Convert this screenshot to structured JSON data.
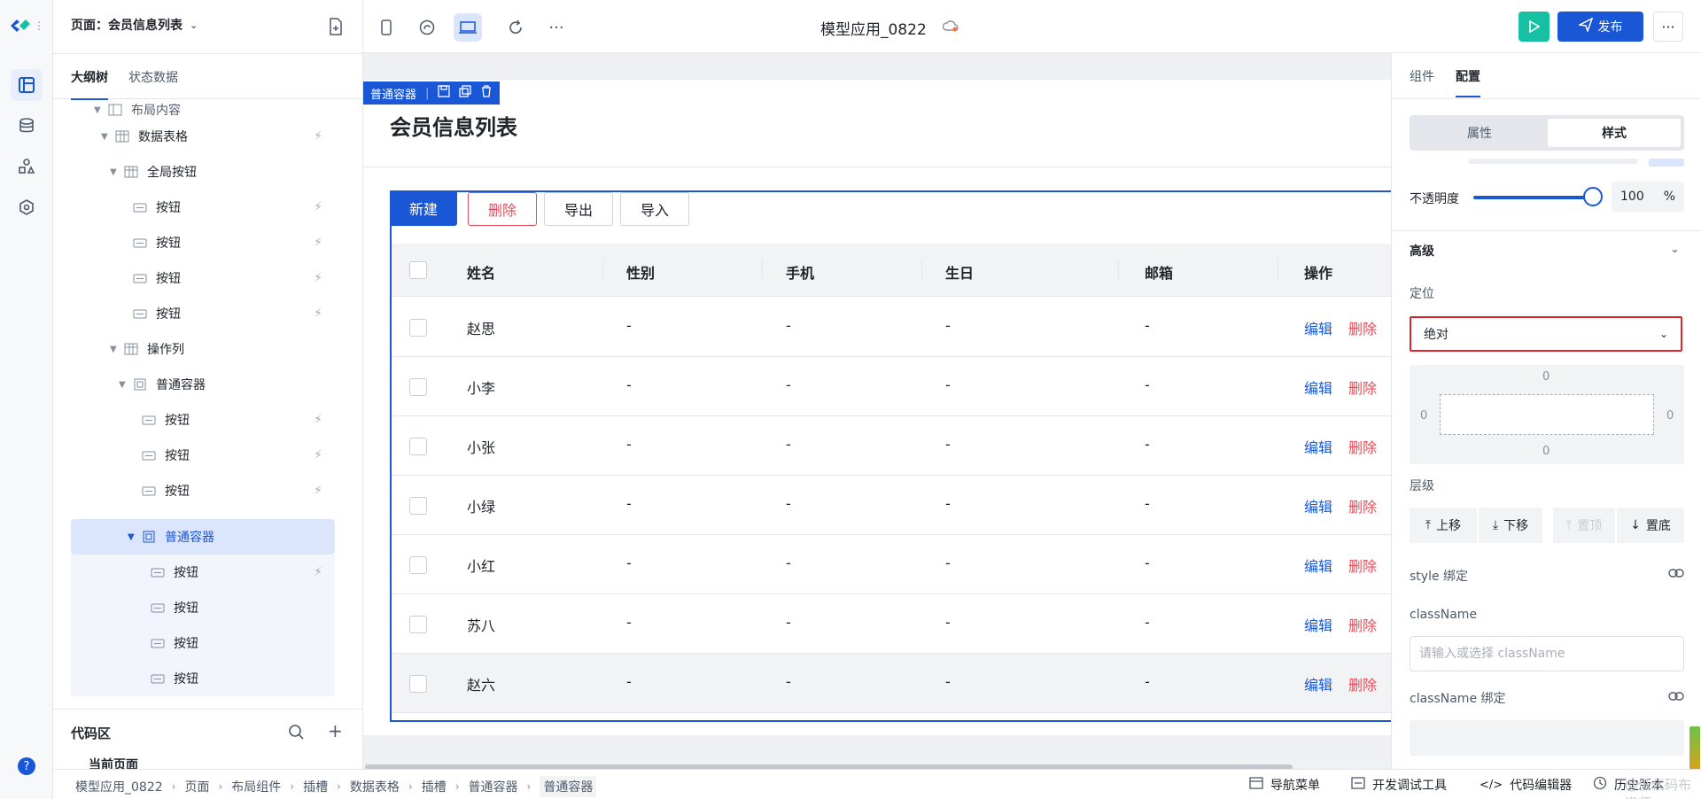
{
  "page_selector": {
    "label": "页面：会员信息列表"
  },
  "outline_tabs": [
    "大纲树",
    "状态数据"
  ],
  "tree": [
    {
      "label": "布局内容"
    },
    {
      "label": "数据表格"
    },
    {
      "label": "全局按钮"
    },
    {
      "label": "按钮"
    },
    {
      "label": "按钮"
    },
    {
      "label": "按钮"
    },
    {
      "label": "按钮"
    },
    {
      "label": "操作列"
    },
    {
      "label": "普通容器"
    },
    {
      "label": "按钮"
    },
    {
      "label": "按钮"
    },
    {
      "label": "按钮"
    },
    {
      "label": "普通容器"
    },
    {
      "label": "按钮"
    },
    {
      "label": "按钮"
    },
    {
      "label": "按钮"
    },
    {
      "label": "按钮"
    }
  ],
  "code_area": {
    "title": "代码区",
    "item": "当前页面"
  },
  "toolbar": {
    "app_title": "模型应用_0822",
    "publish_label": "发布"
  },
  "canvas": {
    "container_tag": "普通容器",
    "heading": "会员信息列表",
    "actions": {
      "new": "新建",
      "delete": "删除",
      "export": "导出",
      "import": "导入"
    },
    "columns": [
      "姓名",
      "性别",
      "手机",
      "生日",
      "邮箱",
      "操作"
    ],
    "rows": [
      {
        "name": "赵思",
        "gender": "-",
        "phone": "-",
        "birthday": "-",
        "email": "-"
      },
      {
        "name": "小李",
        "gender": "-",
        "phone": "-",
        "birthday": "-",
        "email": "-"
      },
      {
        "name": "小张",
        "gender": "-",
        "phone": "-",
        "birthday": "-",
        "email": "-"
      },
      {
        "name": "小绿",
        "gender": "-",
        "phone": "-",
        "birthday": "-",
        "email": "-"
      },
      {
        "name": "小红",
        "gender": "-",
        "phone": "-",
        "birthday": "-",
        "email": "-"
      },
      {
        "name": "苏八",
        "gender": "-",
        "phone": "-",
        "birthday": "-",
        "email": "-"
      },
      {
        "name": "赵六",
        "gender": "-",
        "phone": "-",
        "birthday": "-",
        "email": "-"
      }
    ],
    "row_edit": "编辑",
    "row_delete": "删除"
  },
  "right_panel": {
    "tabs": [
      "组件",
      "配置"
    ],
    "segments": [
      "属性",
      "样式"
    ],
    "opacity": {
      "label": "不透明度",
      "value": "100",
      "unit": "%",
      "level": 1.0
    },
    "advanced": "高级",
    "position": {
      "label": "定位",
      "value": "绝对"
    },
    "offsets": {
      "top": "0",
      "right": "0",
      "bottom": "0",
      "left": "0"
    },
    "layer": {
      "label": "层级",
      "up": "上移",
      "down": "下移",
      "top": "置顶",
      "bottom": "置底"
    },
    "style_bind": "style 绑定",
    "classname": {
      "label": "className",
      "placeholder": "请输入或选择 className"
    },
    "classname_bind": "className 绑定"
  },
  "bottom": {
    "breadcrumb": [
      "模型应用_0822",
      "页面",
      "布局组件",
      "插槽",
      "数据表格",
      "插槽",
      "普通容器",
      "普通容器"
    ],
    "nav_menu": "导航菜单",
    "dev_tools": "开发调试工具",
    "code_editor": "代码编辑器",
    "watermark": "@低代码布道师",
    "version": "历史版本"
  },
  "colors": {
    "accent": "#1a57d6",
    "danger": "#e34d59",
    "run": "#16c1a3",
    "highlight_border": "#d9262b"
  }
}
